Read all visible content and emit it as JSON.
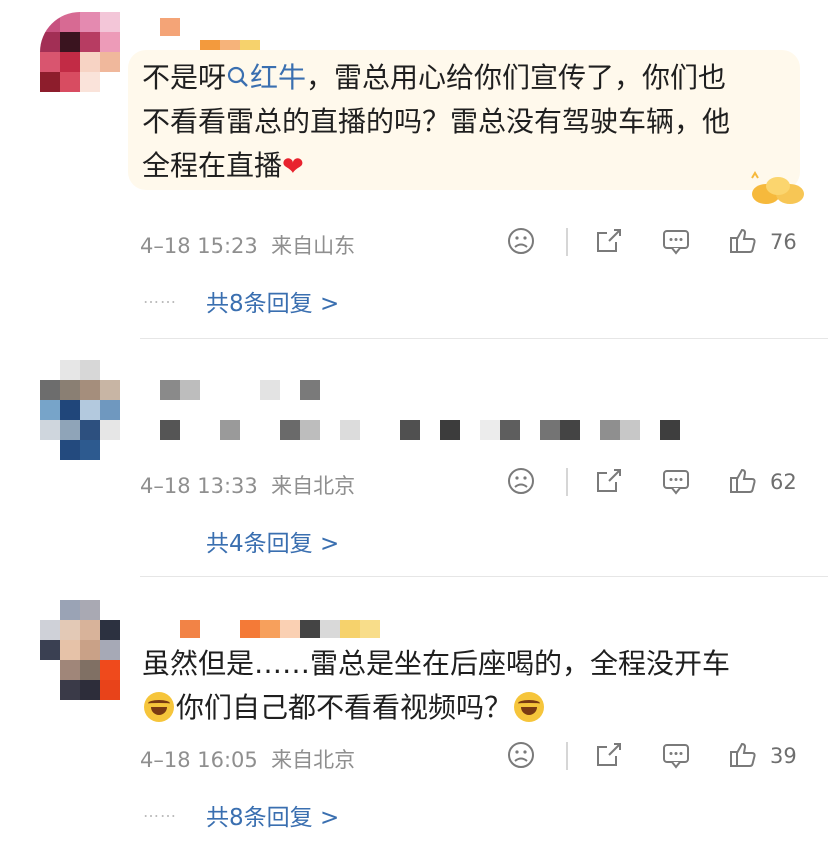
{
  "comments": [
    {
      "text_prefix": "不是呀",
      "topic_label": "红牛",
      "text_rest": "，雷总用心给你们宣传了，你们也",
      "text_line2": "不看看雷总的直播的吗？雷总没有驾驶车辆，他",
      "text_line3": "全程在直播",
      "timestamp": "4–18 15:23",
      "location": "来自山东",
      "like_count": "76",
      "replies_label": "共8条回复 >",
      "more_dots": "……"
    },
    {
      "timestamp": "4–18 13:33",
      "location": "来自北京",
      "like_count": "62",
      "replies_label": "共4条回复 >"
    },
    {
      "text_line1": "虽然但是……雷总是坐在后座喝的，全程没开车",
      "text_line2": "你们自己都不看看视频吗？",
      "timestamp": "4–18 16:05",
      "location": "来自北京",
      "like_count": "39",
      "replies_label": "共8条回复 >",
      "more_dots": "……"
    }
  ],
  "icons": {
    "dislike": "frown-face-icon",
    "share": "share-icon",
    "reply": "comment-icon",
    "like": "thumbs-up-icon",
    "search": "search-icon",
    "heart": "heart-icon",
    "laugh_cry": "laugh-cry-emoji-icon"
  },
  "colors": {
    "link": "#3a6fb0",
    "bubble": "#fff9ec",
    "meta": "#8f8f8f",
    "heart": "#e8232e"
  }
}
